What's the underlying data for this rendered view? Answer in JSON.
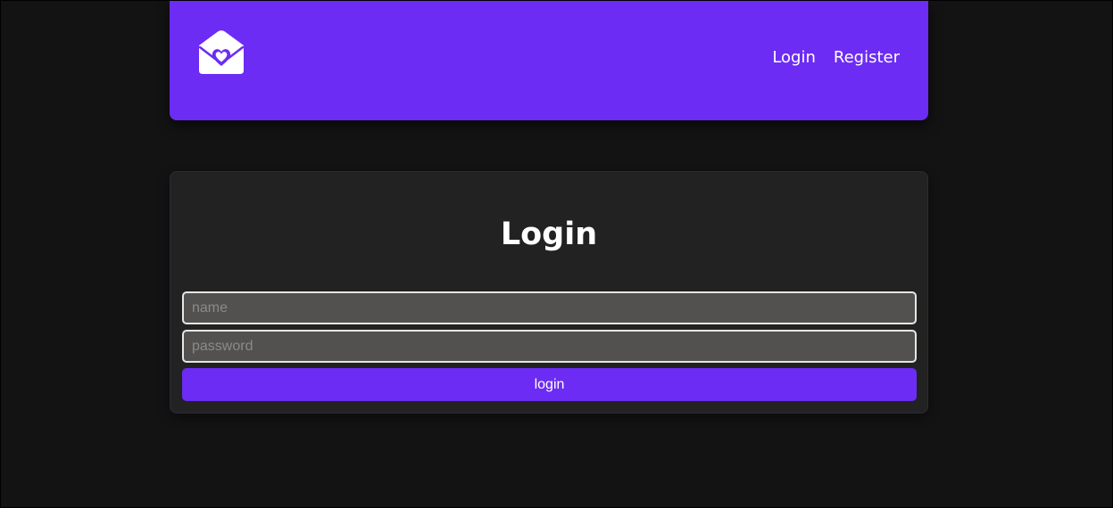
{
  "header": {
    "logo_icon": "envelope-heart-icon",
    "nav": [
      {
        "label": "Login"
      },
      {
        "label": "Register"
      }
    ]
  },
  "login_form": {
    "title": "Login",
    "name_placeholder": "name",
    "password_placeholder": "password",
    "submit_label": "login"
  },
  "colors": {
    "accent": "#6c2cf3",
    "page_background": "#131313",
    "card_background": "#222222",
    "input_background": "#525150"
  }
}
